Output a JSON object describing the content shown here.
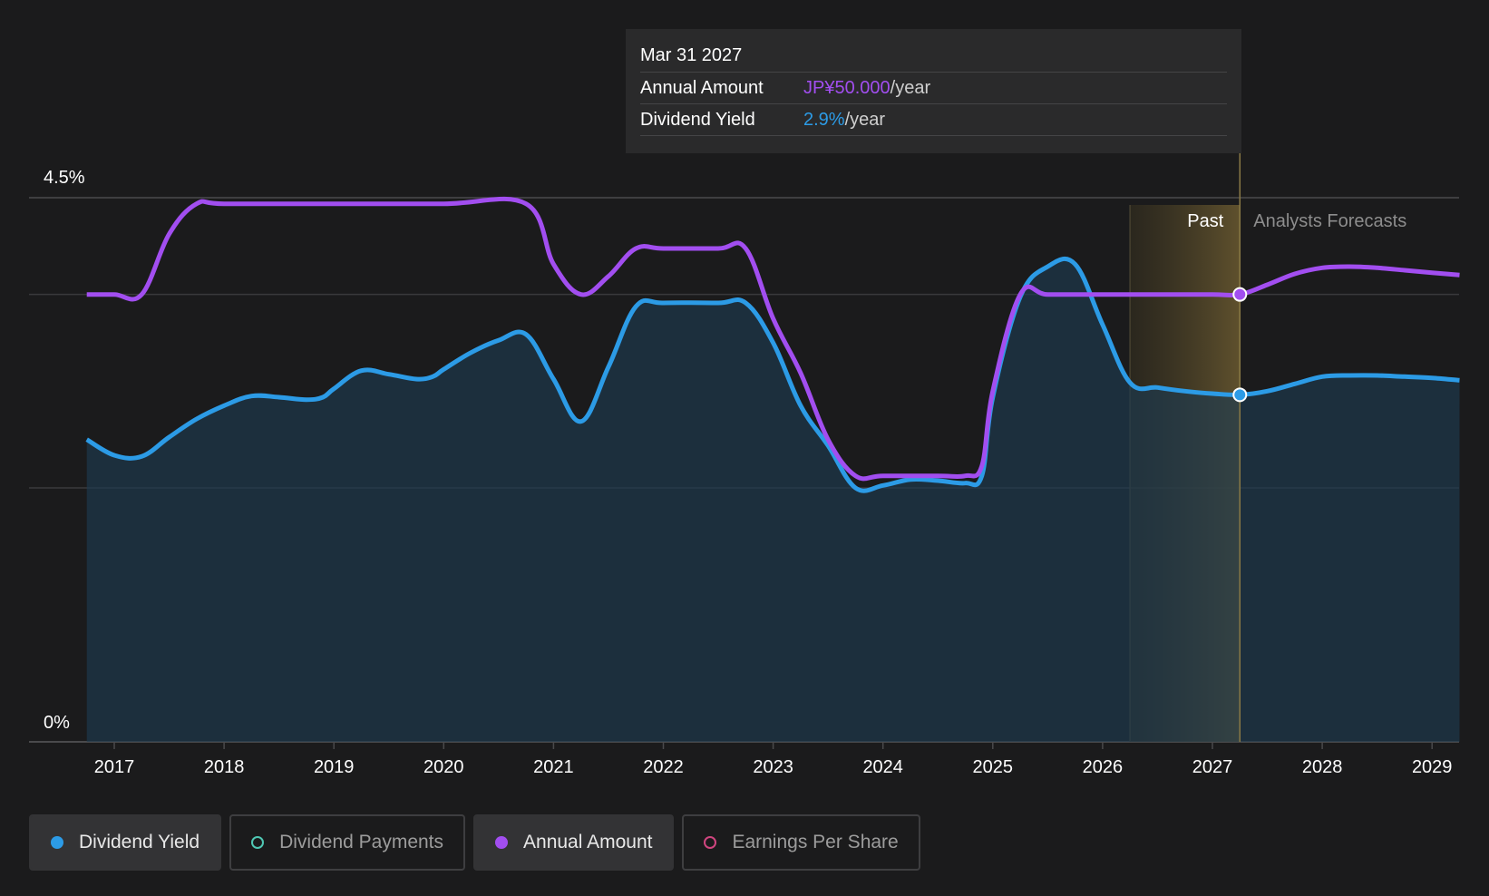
{
  "tooltip": {
    "date": "Mar 31 2027",
    "rows": [
      {
        "label": "Annual Amount",
        "value": "JP¥50.000",
        "unit": "/year",
        "color": "#a24ef0"
      },
      {
        "label": "Dividend Yield",
        "value": "2.9%",
        "unit": "/year",
        "color": "#2c9be6"
      }
    ]
  },
  "region_labels": {
    "past": "Past",
    "forecast": "Analysts Forecasts"
  },
  "legend": [
    {
      "label": "Dividend Yield",
      "color": "#2c9be6",
      "active": true
    },
    {
      "label": "Dividend Payments",
      "color": "#4fc7b3",
      "active": false
    },
    {
      "label": "Annual Amount",
      "color": "#a24ef0",
      "active": true
    },
    {
      "label": "Earnings Per Share",
      "color": "#d0457f",
      "active": false
    }
  ],
  "colors": {
    "yield": "#2c9be6",
    "amount": "#a24ef0",
    "grid": "#3a3a3c",
    "axis_text": "#ffffff"
  },
  "chart_data": {
    "type": "line",
    "x_ticks": [
      "2017",
      "2018",
      "2019",
      "2020",
      "2021",
      "2022",
      "2023",
      "2024",
      "2025",
      "2026",
      "2027",
      "2028",
      "2029"
    ],
    "y_ticks": [
      "0%",
      "4.5%"
    ],
    "ylim_yield": [
      0,
      4.5
    ],
    "xlim": [
      2016.77,
      2029.25
    ],
    "past_range": [
      2026.25,
      2027.25
    ],
    "cursor_x": 2027.25,
    "series": [
      {
        "name": "Dividend Yield",
        "fill": true,
        "points": [
          [
            2016.75,
            2.5
          ],
          [
            2017.0,
            2.37
          ],
          [
            2017.25,
            2.36
          ],
          [
            2017.5,
            2.52
          ],
          [
            2017.75,
            2.67
          ],
          [
            2018.0,
            2.78
          ],
          [
            2018.25,
            2.86
          ],
          [
            2018.5,
            2.85
          ],
          [
            2018.75,
            2.83
          ],
          [
            2018.9,
            2.85
          ],
          [
            2019.0,
            2.92
          ],
          [
            2019.25,
            3.07
          ],
          [
            2019.5,
            3.04
          ],
          [
            2019.75,
            3.0
          ],
          [
            2019.9,
            3.02
          ],
          [
            2020.0,
            3.08
          ],
          [
            2020.25,
            3.22
          ],
          [
            2020.5,
            3.32
          ],
          [
            2020.75,
            3.37
          ],
          [
            2021.0,
            3.0
          ],
          [
            2021.25,
            2.65
          ],
          [
            2021.5,
            3.1
          ],
          [
            2021.75,
            3.6
          ],
          [
            2022.0,
            3.63
          ],
          [
            2022.5,
            3.63
          ],
          [
            2022.75,
            3.63
          ],
          [
            2023.0,
            3.3
          ],
          [
            2023.25,
            2.78
          ],
          [
            2023.5,
            2.45
          ],
          [
            2023.75,
            2.1
          ],
          [
            2024.0,
            2.12
          ],
          [
            2024.25,
            2.17
          ],
          [
            2024.5,
            2.16
          ],
          [
            2024.75,
            2.14
          ],
          [
            2024.9,
            2.2
          ],
          [
            2025.0,
            2.85
          ],
          [
            2025.25,
            3.68
          ],
          [
            2025.5,
            3.93
          ],
          [
            2025.75,
            3.95
          ],
          [
            2026.0,
            3.45
          ],
          [
            2026.25,
            2.97
          ],
          [
            2026.5,
            2.93
          ],
          [
            2026.75,
            2.9
          ],
          [
            2027.0,
            2.88
          ],
          [
            2027.25,
            2.87
          ],
          [
            2027.5,
            2.9
          ],
          [
            2027.75,
            2.96
          ],
          [
            2028.0,
            3.02
          ],
          [
            2028.25,
            3.03
          ],
          [
            2028.5,
            3.03
          ],
          [
            2028.75,
            3.02
          ],
          [
            2029.0,
            3.01
          ],
          [
            2029.25,
            2.99
          ]
        ]
      },
      {
        "name": "Annual Amount",
        "fill": false,
        "points": [
          [
            2016.75,
            3.7
          ],
          [
            2017.0,
            3.7
          ],
          [
            2017.25,
            3.7
          ],
          [
            2017.5,
            4.2
          ],
          [
            2017.75,
            4.45
          ],
          [
            2018.0,
            4.45
          ],
          [
            2019.0,
            4.45
          ],
          [
            2020.0,
            4.45
          ],
          [
            2020.75,
            4.45
          ],
          [
            2021.0,
            3.95
          ],
          [
            2021.25,
            3.7
          ],
          [
            2021.5,
            3.85
          ],
          [
            2021.75,
            4.08
          ],
          [
            2022.0,
            4.08
          ],
          [
            2022.5,
            4.08
          ],
          [
            2022.75,
            4.08
          ],
          [
            2023.0,
            3.5
          ],
          [
            2023.25,
            3.05
          ],
          [
            2023.5,
            2.5
          ],
          [
            2023.75,
            2.2
          ],
          [
            2024.0,
            2.2
          ],
          [
            2024.5,
            2.2
          ],
          [
            2024.75,
            2.2
          ],
          [
            2024.9,
            2.28
          ],
          [
            2025.0,
            2.9
          ],
          [
            2025.25,
            3.7
          ],
          [
            2025.5,
            3.7
          ],
          [
            2026.0,
            3.7
          ],
          [
            2026.5,
            3.7
          ],
          [
            2027.0,
            3.7
          ],
          [
            2027.25,
            3.7
          ],
          [
            2027.5,
            3.78
          ],
          [
            2027.75,
            3.87
          ],
          [
            2028.0,
            3.92
          ],
          [
            2028.25,
            3.93
          ],
          [
            2028.5,
            3.92
          ],
          [
            2028.75,
            3.9
          ],
          [
            2029.0,
            3.88
          ],
          [
            2029.25,
            3.86
          ]
        ]
      }
    ]
  }
}
